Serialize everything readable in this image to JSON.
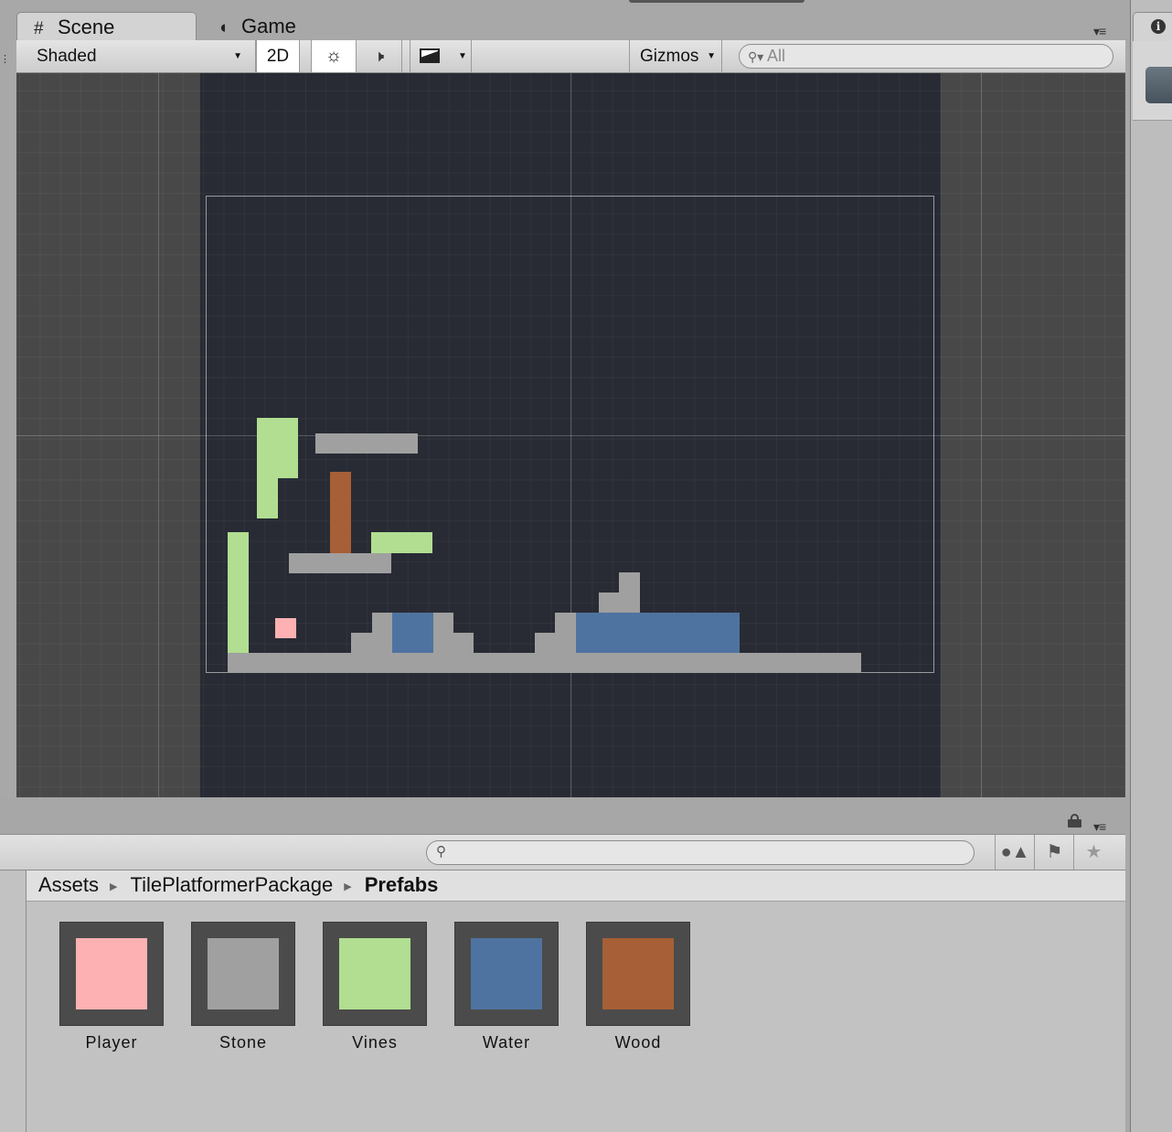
{
  "tabs": {
    "scene": {
      "label": "Scene",
      "icon": "grid-icon"
    },
    "game": {
      "label": "Game",
      "icon": "pacman-icon"
    }
  },
  "toolbar": {
    "shading_mode": "Shaded",
    "mode_2d": "2D",
    "lighting_icon": "sun-icon",
    "audio_icon": "speaker-icon",
    "effects_icon": "image-icon",
    "gizmos_label": "Gizmos",
    "search_placeholder": "All"
  },
  "scene": {
    "background_color": "#484848",
    "camera_area_color": "#282b34",
    "tile_colors": {
      "stone": "#a0a0a0",
      "vines": "#b1de91",
      "water": "#4f73a0",
      "wood": "#a65f36",
      "player": "#fdb1b2"
    }
  },
  "project": {
    "search_placeholder": "",
    "breadcrumb": [
      "Assets",
      "TilePlatformerPackage",
      "Prefabs"
    ],
    "assets": [
      {
        "label": "Player",
        "color": "#fdb1b2"
      },
      {
        "label": "Stone",
        "color": "#a0a0a0"
      },
      {
        "label": "Vines",
        "color": "#b1de91"
      },
      {
        "label": "Water",
        "color": "#4f73a0"
      },
      {
        "label": "Wood",
        "color": "#a65f36"
      }
    ]
  },
  "inspector": {
    "icon": "info-icon"
  }
}
